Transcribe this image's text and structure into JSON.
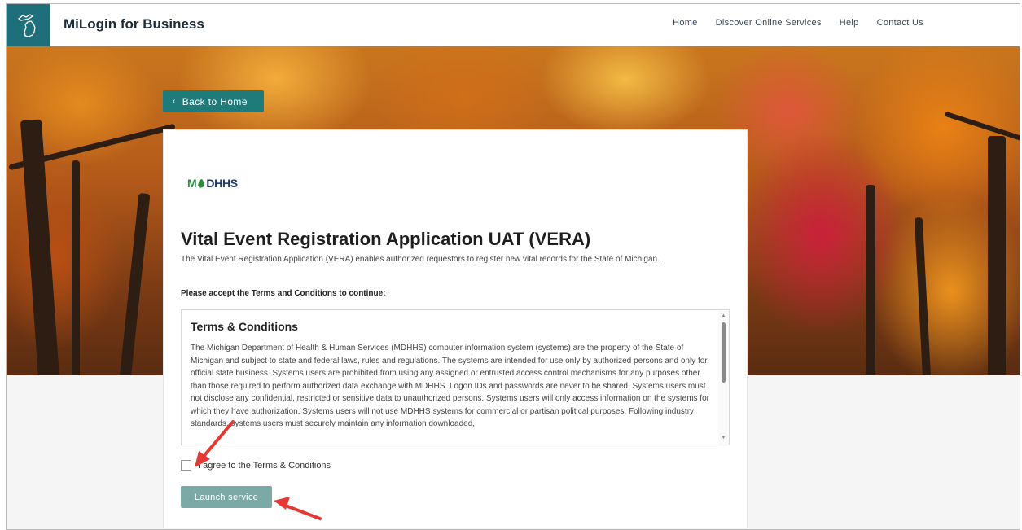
{
  "header": {
    "brand": "MiLogin for Business",
    "nav": [
      "Home",
      "Discover Online Services",
      "Help",
      "Contact Us"
    ]
  },
  "hero": {
    "back_label": "Back to Home"
  },
  "card": {
    "agency_logo_text": "DHHS",
    "agency_logo_prefix": "M",
    "title": "Vital Event Registration Application UAT (VERA)",
    "description": "The Vital Event Registration Application (VERA) enables authorized requestors to register new vital records for the State of Michigan.",
    "prompt": "Please accept the Terms and Conditions to continue:",
    "terms": {
      "title": "Terms & Conditions",
      "body": "The Michigan Department of Health & Human Services (MDHHS) computer information system (systems) are the property of the State of Michigan and subject to state and federal laws, rules and regulations. The systems are intended for use only by authorized persons and only for official state business. Systems users are prohibited from using any assigned or entrusted access control mechanisms for any purposes other than those required to perform authorized data exchange with MDHHS. Logon IDs and passwords are never to be shared. Systems users must not disclose any confidential, restricted or sensitive data to unauthorized persons. Systems users will only access information on the systems for which they have authorization. Systems users will not use MDHHS systems for commercial or partisan political purposes. Following industry standards, systems users must securely maintain any information downloaded,"
    },
    "agree_label": "I agree to the Terms & Conditions",
    "agree_checked": false,
    "launch_label": "Launch service"
  },
  "colors": {
    "brand_teal": "#1f6f7a",
    "button_teal": "#1f7a7a",
    "launch_disabled": "#7aa9a6",
    "annotation_red": "#e53935"
  }
}
